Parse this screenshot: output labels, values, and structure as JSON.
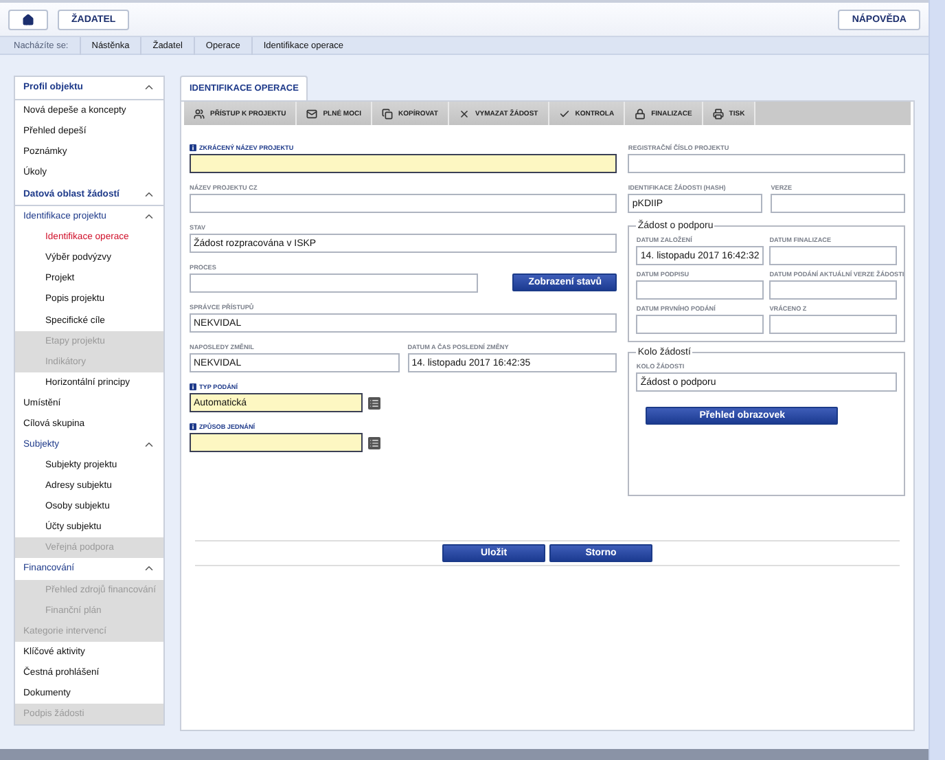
{
  "top_bar": {
    "buttons": [
      "ŽADATEL"
    ],
    "help": "NÁPOVĚDA"
  },
  "breadcrumb": {
    "label": "Nacházíte se:",
    "items": [
      "Nástěnka",
      "Žadatel",
      "Operace",
      "Identifikace operace"
    ]
  },
  "sidebar": {
    "sections": [
      {
        "label": "Profil objektu",
        "expanded": true,
        "items": [
          {
            "label": "Nová depeše a koncepty",
            "selected": false,
            "disabled": false
          },
          {
            "label": "Přehled depeší",
            "selected": false,
            "disabled": false
          },
          {
            "label": "Poznámky",
            "selected": false,
            "disabled": false
          },
          {
            "label": "Úkoly",
            "selected": false,
            "disabled": false
          }
        ]
      },
      {
        "label": "Datová oblast žádostí",
        "expanded": true,
        "items": [
          {
            "label": "Identifikace projektu",
            "selected": false,
            "disabled": false,
            "expanded": true,
            "children": [
              {
                "label": "Identifikace operace",
                "selected": true,
                "disabled": false
              },
              {
                "label": "Výběr podvýzvy",
                "selected": false,
                "disabled": false
              },
              {
                "label": "Projekt",
                "selected": false,
                "disabled": false
              },
              {
                "label": "Popis projektu",
                "selected": false,
                "disabled": false
              },
              {
                "label": "Specifické cíle",
                "selected": false,
                "disabled": false
              },
              {
                "label": "Etapy projektu",
                "selected": false,
                "disabled": true
              },
              {
                "label": "Indikátory",
                "selected": false,
                "disabled": true
              },
              {
                "label": "Horizontální principy",
                "selected": false,
                "disabled": false
              }
            ]
          },
          {
            "label": "Umístění",
            "selected": false,
            "disabled": false
          },
          {
            "label": "Cílová skupina",
            "selected": false,
            "disabled": false
          },
          {
            "label": "Subjekty",
            "selected": false,
            "disabled": false,
            "expanded": true,
            "children": [
              {
                "label": "Subjekty projektu",
                "selected": false,
                "disabled": false
              },
              {
                "label": "Adresy subjektu",
                "selected": false,
                "disabled": false
              },
              {
                "label": "Osoby subjektu",
                "selected": false,
                "disabled": false
              },
              {
                "label": "Účty subjektu",
                "selected": false,
                "disabled": false
              },
              {
                "label": "Veřejná podpora",
                "selected": false,
                "disabled": true
              }
            ]
          },
          {
            "label": "Financování",
            "selected": false,
            "disabled": false,
            "expanded": true,
            "children": [
              {
                "label": "Přehled zdrojů financování",
                "selected": false,
                "disabled": true
              },
              {
                "label": "Finanční plán",
                "selected": false,
                "disabled": true
              }
            ]
          },
          {
            "label": "Kategorie intervencí",
            "selected": false,
            "disabled": true
          },
          {
            "label": "Klíčové aktivity",
            "selected": false,
            "disabled": false
          },
          {
            "label": "Čestná prohlášení",
            "selected": false,
            "disabled": false
          },
          {
            "label": "Dokumenty",
            "selected": false,
            "disabled": false
          },
          {
            "label": "Podpis žádosti",
            "selected": false,
            "disabled": true
          }
        ]
      }
    ]
  },
  "tab": {
    "label": "IDENTIFIKACE OPERACE",
    "selected": true
  },
  "toolbar": [
    "PŘÍSTUP K PROJEKTU",
    "PLNÉ MOCI",
    "KOPÍROVAT",
    "VYMAZAT ŽÁDOST",
    "KONTROLA",
    "FINALIZACE",
    "TISK"
  ],
  "left_rows": [
    {
      "fields": [
        {
          "label": "ZKRÁCENÝ NÁZEV PROJEKTU",
          "required": true,
          "kind": "text"
        }
      ]
    },
    {
      "fields": [
        {
          "label": "NÁZEV PROJEKTU CZ",
          "required": false,
          "kind": "text"
        }
      ]
    },
    {
      "fields": [
        {
          "label": "STAV",
          "value": "Žádost rozpracována v ISKP",
          "required": false,
          "kind": "text"
        }
      ]
    },
    {
      "fields": [
        {
          "label": "PROCES",
          "required": false,
          "kind": "text"
        }
      ],
      "button": "Zobrazení stavů"
    },
    {
      "fields": [
        {
          "label": "SPRÁVCE PŘÍSTUPŮ",
          "value": "NEKVIDAL",
          "required": false,
          "kind": "text"
        }
      ]
    },
    {
      "fields": [
        {
          "label": "NAPOSLEDY ZMĚNIL",
          "value": "NEKVIDAL",
          "required": false,
          "kind": "text"
        },
        {
          "label": "DATUM A ČAS POSLEDNÍ ZMĚNY",
          "value": "14. listopadu 2017 16:42:35",
          "required": false,
          "kind": "text"
        }
      ]
    },
    {
      "fields": [
        {
          "label": "TYP PODÁNÍ",
          "value": "Automatická",
          "required": true,
          "kind": "lookup"
        }
      ]
    },
    {
      "fields": [
        {
          "label": "ZPŮSOB JEDNÁNÍ",
          "required": true,
          "kind": "lookup"
        }
      ]
    }
  ],
  "right_rows": [
    {
      "fields": [
        {
          "label": "REGISTRAČNÍ ČÍSLO PROJEKTU",
          "required": false,
          "kind": "text"
        }
      ]
    },
    {
      "fields": [
        {
          "label": "IDENTIFIKACE ŽÁDOSTI (HASH)",
          "value": "pKDIIP",
          "required": false,
          "kind": "text"
        },
        {
          "label": "VERZE",
          "required": false,
          "kind": "text"
        }
      ]
    }
  ],
  "groups": [
    {
      "legend": "Žádost o podporu",
      "fields": [
        {
          "label": "DATUM ZALOŽENÍ",
          "value": "14. listopadu 2017 16:42:32",
          "required": false,
          "kind": "text"
        },
        {
          "label": "DATUM FINALIZACE",
          "required": false,
          "kind": "text"
        },
        {
          "label": "DATUM PODPISU",
          "required": false,
          "kind": "text"
        },
        {
          "label": "DATUM PODÁNÍ AKTUÁLNÍ VERZE ŽÁDOSTI",
          "required": false,
          "kind": "text"
        },
        {
          "label": "DATUM PRVNÍHO PODÁNÍ",
          "required": false,
          "kind": "text"
        },
        {
          "label": "VRÁCENO Z",
          "required": false,
          "kind": "text"
        }
      ]
    },
    {
      "legend": "Kolo žádostí",
      "fields": [
        {
          "label": "KOLO ŽÁDOSTI",
          "value": "Žádost o podporu",
          "required": false,
          "kind": "text"
        }
      ],
      "button": "Přehled obrazovek"
    }
  ],
  "actions": [
    "Uložit",
    "Storno"
  ]
}
